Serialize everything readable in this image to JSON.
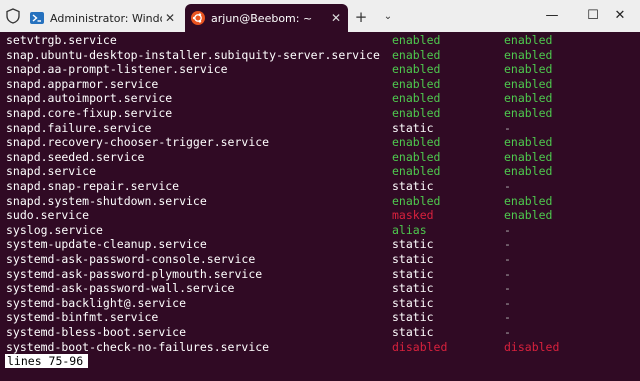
{
  "window": {
    "tabs": [
      {
        "label": "Administrator: Windows Powe",
        "close": "✕",
        "active": false,
        "icon": "powershell-icon"
      },
      {
        "label": "arjun@Beebom: ~",
        "close": "✕",
        "active": true,
        "icon": "ubuntu-icon"
      }
    ],
    "new_tab": "+",
    "dropdown": "⌄",
    "minimize": "—",
    "maximize": "☐",
    "close": "✕",
    "colors": {
      "terminal_bg": "#300a24",
      "enabled": "#4ec94e",
      "masked": "#d8213d",
      "ubuntu_orange": "#e95420"
    }
  },
  "terminal": {
    "rows": [
      {
        "unit": "setvtrgb.service",
        "state": "enabled",
        "preset": "enabled"
      },
      {
        "unit": "snap.ubuntu-desktop-installer.subiquity-server.service",
        "state": "enabled",
        "preset": "enabled"
      },
      {
        "unit": "snapd.aa-prompt-listener.service",
        "state": "enabled",
        "preset": "enabled"
      },
      {
        "unit": "snapd.apparmor.service",
        "state": "enabled",
        "preset": "enabled"
      },
      {
        "unit": "snapd.autoimport.service",
        "state": "enabled",
        "preset": "enabled"
      },
      {
        "unit": "snapd.core-fixup.service",
        "state": "enabled",
        "preset": "enabled"
      },
      {
        "unit": "snapd.failure.service",
        "state": "static",
        "preset": "-"
      },
      {
        "unit": "snapd.recovery-chooser-trigger.service",
        "state": "enabled",
        "preset": "enabled"
      },
      {
        "unit": "snapd.seeded.service",
        "state": "enabled",
        "preset": "enabled"
      },
      {
        "unit": "snapd.service",
        "state": "enabled",
        "preset": "enabled"
      },
      {
        "unit": "snapd.snap-repair.service",
        "state": "static",
        "preset": "-"
      },
      {
        "unit": "snapd.system-shutdown.service",
        "state": "enabled",
        "preset": "enabled"
      },
      {
        "unit": "sudo.service",
        "state": "masked",
        "preset": "enabled"
      },
      {
        "unit": "syslog.service",
        "state": "alias",
        "preset": "-"
      },
      {
        "unit": "system-update-cleanup.service",
        "state": "static",
        "preset": "-"
      },
      {
        "unit": "systemd-ask-password-console.service",
        "state": "static",
        "preset": "-"
      },
      {
        "unit": "systemd-ask-password-plymouth.service",
        "state": "static",
        "preset": "-"
      },
      {
        "unit": "systemd-ask-password-wall.service",
        "state": "static",
        "preset": "-"
      },
      {
        "unit": "systemd-backlight@.service",
        "state": "static",
        "preset": "-"
      },
      {
        "unit": "systemd-binfmt.service",
        "state": "static",
        "preset": "-"
      },
      {
        "unit": "systemd-bless-boot.service",
        "state": "static",
        "preset": "-"
      },
      {
        "unit": "systemd-boot-check-no-failures.service",
        "state": "disabled",
        "preset": "disabled"
      }
    ],
    "pager_status": "lines 75-96"
  }
}
